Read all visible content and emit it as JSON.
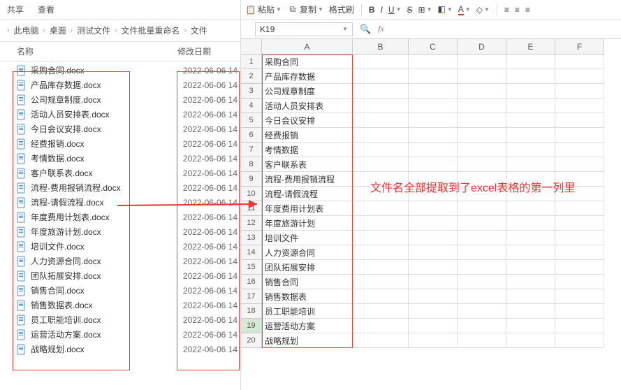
{
  "left": {
    "tabs": [
      "共享",
      "查看"
    ],
    "breadcrumb": [
      "此电脑",
      "桌面",
      "测试文件",
      "文件批量重命名",
      "文件"
    ],
    "cols": {
      "name": "名称",
      "date": "修改日期"
    },
    "files": [
      {
        "name": "采购合同.docx",
        "date": "2022-06-06 14"
      },
      {
        "name": "产品库存数据.docx",
        "date": "2022-06-06 14"
      },
      {
        "name": "公司规章制度.docx",
        "date": "2022-06-06 14"
      },
      {
        "name": "活动人员安排表.docx",
        "date": "2022-06-06 14"
      },
      {
        "name": "今日会议安排.docx",
        "date": "2022-06-06 14"
      },
      {
        "name": "经费报销.docx",
        "date": "2022-06-06 14"
      },
      {
        "name": "考情数据.docx",
        "date": "2022-06-06 14"
      },
      {
        "name": "客户联系表.docx",
        "date": "2022-06-06 14"
      },
      {
        "name": "流程-费用报销流程.docx",
        "date": "2022-06-06 14"
      },
      {
        "name": "流程-请假流程.docx",
        "date": "2022-06-06 14"
      },
      {
        "name": "年度费用计划表.docx",
        "date": "2022-06-06 14"
      },
      {
        "name": "年度旅游计划.docx",
        "date": "2022-06-06 14"
      },
      {
        "name": "培训文件.docx",
        "date": "2022-06-06 14"
      },
      {
        "name": "人力资源合同.docx",
        "date": "2022-06-06 14"
      },
      {
        "name": "团队拓展安排.docx",
        "date": "2022-06-06 14"
      },
      {
        "name": "销售合同.docx",
        "date": "2022-06-06 14"
      },
      {
        "name": "销售数据表.docx",
        "date": "2022-06-06 14"
      },
      {
        "name": "员工职能培训.docx",
        "date": "2022-06-06 14"
      },
      {
        "name": "运营活动方案.docx",
        "date": "2022-06-06 14"
      },
      {
        "name": "战略规划.docx",
        "date": "2022-06-06 14"
      }
    ]
  },
  "right": {
    "toolbar": {
      "paste": "粘贴",
      "copy": "复制",
      "format": "格式刷"
    },
    "namebox": "K19",
    "fx": "fx",
    "cols": [
      "A",
      "B",
      "C",
      "D",
      "E",
      "F"
    ],
    "rows": [
      1,
      2,
      3,
      4,
      5,
      6,
      7,
      8,
      9,
      10,
      11,
      12,
      13,
      14,
      15,
      16,
      17,
      18,
      19,
      20
    ],
    "selectedRow": 19,
    "colA": [
      "采购合同",
      "产品库存数据",
      "公司规章制度",
      "活动人员安排表",
      "今日会议安排",
      "经费报销",
      "考情数据",
      "客户联系表",
      "流程-费用报销流程",
      "流程-请假流程",
      "年度费用计划表",
      "年度旅游计划",
      "培训文件",
      "人力资源合同",
      "团队拓展安排",
      "销售合同",
      "销售数据表",
      "员工职能培训",
      "运营活动方案",
      "战略规划"
    ]
  },
  "annotation": "文件名全部提取到了excel表格的第一列里"
}
